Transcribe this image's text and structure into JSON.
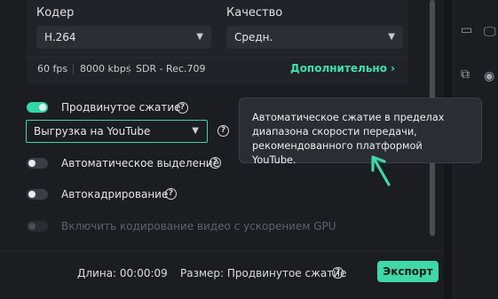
{
  "codec": {
    "label": "Кодер",
    "value": "H.264"
  },
  "quality": {
    "label": "Качество",
    "value": "Средн."
  },
  "info": {
    "fps": "60 fps",
    "bitrate": "8000 kbps",
    "range": "SDR - Rec.709",
    "more_label": "Дополнительно"
  },
  "options": {
    "advanced_compression": {
      "label": "Продвинутое сжатие",
      "enabled": true,
      "preset": "Выгрузка на YouTube"
    },
    "auto_highlight": {
      "label": "Автоматическое выделение",
      "enabled": false
    },
    "auto_reframe": {
      "label": "Автокадрирование",
      "enabled": false
    },
    "gpu_encoding": {
      "label": "Включить кодирование видео с ускорением GPU",
      "enabled": false,
      "disabled": true
    }
  },
  "tooltip": {
    "text": "Автоматическое сжатие в пределах диапазона скорости передачи, рекомендованного платформой YouTube."
  },
  "footer": {
    "duration": "Длина: 00:00:09",
    "size": "Размер: Продвинутое сжатие",
    "export_label": "Экспорт"
  },
  "colors": {
    "accent": "#3fd8a7",
    "panel": "#1b1d21"
  }
}
